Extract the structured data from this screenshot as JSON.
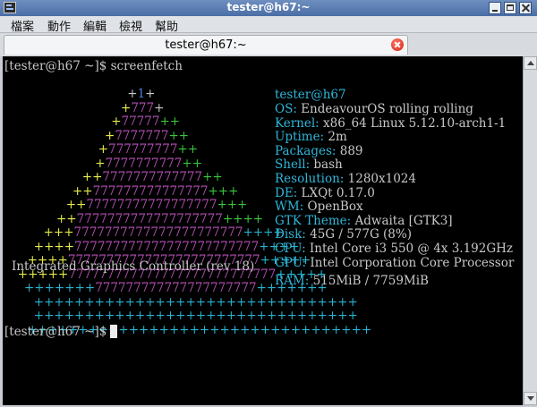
{
  "window": {
    "title": "tester@h67:~"
  },
  "menu": [
    "檔案",
    "動作",
    "編輯",
    "檢視",
    "幫助"
  ],
  "tab": {
    "title": "tester@h67:~"
  },
  "terminal": {
    "command_line": {
      "prompt": "[tester@h67 ~]$",
      "command": " screenfetch"
    },
    "final_prompt": "[tester@h67 ~]$",
    "logo_rows": [
      [
        [
          "a",
          "+"
        ],
        [
          "b",
          "1"
        ],
        [
          "a",
          "+"
        ]
      ],
      [
        [
          "y",
          "+"
        ],
        [
          "m",
          "777"
        ],
        [
          "a",
          "+"
        ]
      ],
      [
        [
          "y",
          "+"
        ],
        [
          "m",
          "77777"
        ],
        [
          "g",
          "++"
        ]
      ],
      [
        [
          "y",
          "+"
        ],
        [
          "m",
          "7777777"
        ],
        [
          "g",
          "++"
        ]
      ],
      [
        [
          "y",
          "+"
        ],
        [
          "m",
          "777777777"
        ],
        [
          "g",
          "++"
        ]
      ],
      [
        [
          "y",
          "+"
        ],
        [
          "m",
          "7777777777"
        ],
        [
          "g",
          "++"
        ]
      ],
      [
        [
          "y",
          "++"
        ],
        [
          "m",
          "7777777777777"
        ],
        [
          "g",
          "++"
        ]
      ],
      [
        [
          "y",
          "++"
        ],
        [
          "m",
          "777777777777777"
        ],
        [
          "g",
          "+++"
        ]
      ],
      [
        [
          "y",
          "++"
        ],
        [
          "m",
          "77777777777777777"
        ],
        [
          "g",
          "+++"
        ]
      ],
      [
        [
          "y",
          "++"
        ],
        [
          "m",
          "7777777777777777777"
        ],
        [
          "g",
          "++++"
        ]
      ],
      [
        [
          "y",
          "+++"
        ],
        [
          "m",
          "7777777777777777777777"
        ],
        [
          "c",
          "++++"
        ]
      ],
      [
        [
          "y",
          "++++"
        ],
        [
          "m",
          "777777777777777777777777"
        ],
        [
          "c",
          "++++"
        ]
      ],
      [
        [
          "y",
          "++++"
        ],
        [
          "m",
          "7777777777777777777777777"
        ],
        [
          "c",
          "+++++"
        ]
      ],
      [
        [
          "y",
          "+++++"
        ],
        [
          "m",
          "777777777777777777777777777"
        ],
        [
          "c",
          "+++++"
        ]
      ],
      [
        [
          "c",
          "+++++++"
        ],
        [
          "m",
          "777777777777777777777"
        ],
        [
          "c",
          "+++++++"
        ]
      ],
      [
        [
          "c",
          "++++++++++++++++++++++++++++++++"
        ]
      ],
      [
        [
          "c",
          "++++++++++++++++++++++++++++++++"
        ]
      ],
      [
        [
          "c",
          "++++++++++++++++++++++++++++++++++"
        ]
      ]
    ],
    "overlay_text": "Integrated Graphics Controller (rev 18)",
    "user_host": "tester@h67",
    "info": [
      {
        "key": "OS:",
        "val": "EndeavourOS rolling rolling"
      },
      {
        "key": "Kernel:",
        "val": "x86_64 Linux 5.12.10-arch1-1"
      },
      {
        "key": "Uptime:",
        "val": "2m"
      },
      {
        "key": "Packages:",
        "val": "889"
      },
      {
        "key": "Shell:",
        "val": "bash"
      },
      {
        "key": "Resolution:",
        "val": "1280x1024"
      },
      {
        "key": "DE:",
        "val": "LXQt 0.17.0"
      },
      {
        "key": "WM:",
        "val": "OpenBox"
      },
      {
        "key": "GTK Theme:",
        "val": "Adwaita [GTK3]"
      },
      {
        "key": "Disk:",
        "val": "45G / 577G (8%)"
      },
      {
        "key": "CPU:",
        "val": "Intel Core i3 550 @ 4x 3.192GHz"
      },
      {
        "key": "GPU:",
        "val": "Intel Corporation Core Processor"
      }
    ],
    "ram": {
      "key": "RAM:",
      "val": "515MiB / 7759MiB"
    }
  }
}
